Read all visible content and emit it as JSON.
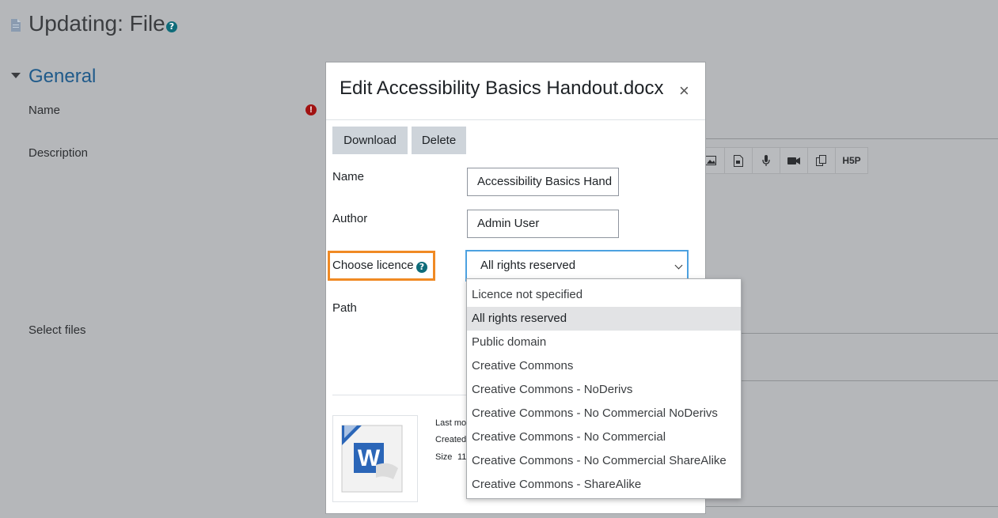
{
  "page": {
    "title": "Updating: File",
    "section": "General",
    "labels": {
      "name": "Name",
      "description": "Description",
      "select_files": "Select files"
    }
  },
  "modal": {
    "title": "Edit Accessibility Basics Handout.docx",
    "close": "×",
    "buttons": {
      "download": "Download",
      "delete": "Delete"
    },
    "fields": {
      "name_label": "Name",
      "name_value": "Accessibility Basics Hand",
      "author_label": "Author",
      "author_value": "Admin User",
      "licence_label": "Choose licence",
      "licence_value": "All rights reserved",
      "path_label": "Path"
    },
    "meta": {
      "last_modified": "Last mo",
      "created": "Created",
      "size_label": "Size",
      "size_value": "11"
    },
    "thumb_letter": "W"
  },
  "dropdown": {
    "options": [
      "Licence not specified",
      "All rights reserved",
      "Public domain",
      "Creative Commons",
      "Creative Commons - NoDerivs",
      "Creative Commons - No Commercial NoDerivs",
      "Creative Commons - No Commercial",
      "Creative Commons - No Commercial ShareAlike",
      "Creative Commons - ShareAlike"
    ],
    "selected_index": 1
  },
  "toolbar": {
    "h5p_label": "H5P"
  },
  "colors": {
    "overlay": "#b5b7ba",
    "accent": "#0f6c7a",
    "highlight": "#f08a24",
    "focus": "#4ca1e0",
    "required": "#a11212"
  }
}
